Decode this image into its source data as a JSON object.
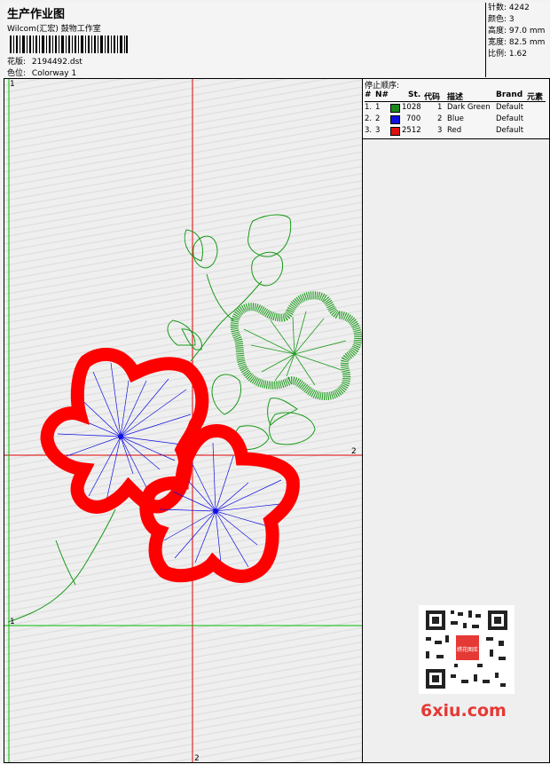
{
  "header": {
    "title": "生产作业图",
    "subtitle": "Wilcom(汇宏) 鼓物工作室",
    "design_label": "花版:",
    "design_value": "2194492.dst",
    "color_label": "色位:",
    "color_value": "Colorway 1"
  },
  "stats": {
    "stitches_label": "针数:",
    "stitches": "4242",
    "colors_label": "颜色:",
    "colors": "3",
    "height_label": "高度:",
    "height": "97.0 mm",
    "width_label": "宽度:",
    "width": "82.5 mm",
    "scale_label": "比例:",
    "scale": "1.62"
  },
  "stop_list": {
    "title": "停止顺序:",
    "columns": {
      "num": "#",
      "no": "N#",
      "st": "St.",
      "code": "代码",
      "desc": "描述",
      "brand": "Brand",
      "element": "元素"
    },
    "rows": [
      {
        "num": "1.",
        "no": "1",
        "color": "#1a8a1a",
        "st": "1028",
        "code": "1",
        "desc": "Dark Green",
        "brand": "Default"
      },
      {
        "num": "2.",
        "no": "2",
        "color": "#1010e0",
        "st": "700",
        "code": "2",
        "desc": "Blue",
        "brand": "Default"
      },
      {
        "num": "3.",
        "no": "3",
        "color": "#e01010",
        "st": "2512",
        "code": "3",
        "desc": "Red",
        "brand": "Default"
      }
    ]
  },
  "axes": {
    "top_left": "1",
    "bottom_left": "1",
    "right_mark": "2",
    "bottom_mark": "2"
  },
  "watermark": {
    "logo_text": "6xiu.com",
    "qr_center_text": "绣花图库"
  },
  "colors": {
    "green": "#1a9a1a",
    "blue": "#1010e0",
    "red": "#ff0000",
    "guide_red": "#e00000",
    "guide_green": "#00bb00"
  }
}
